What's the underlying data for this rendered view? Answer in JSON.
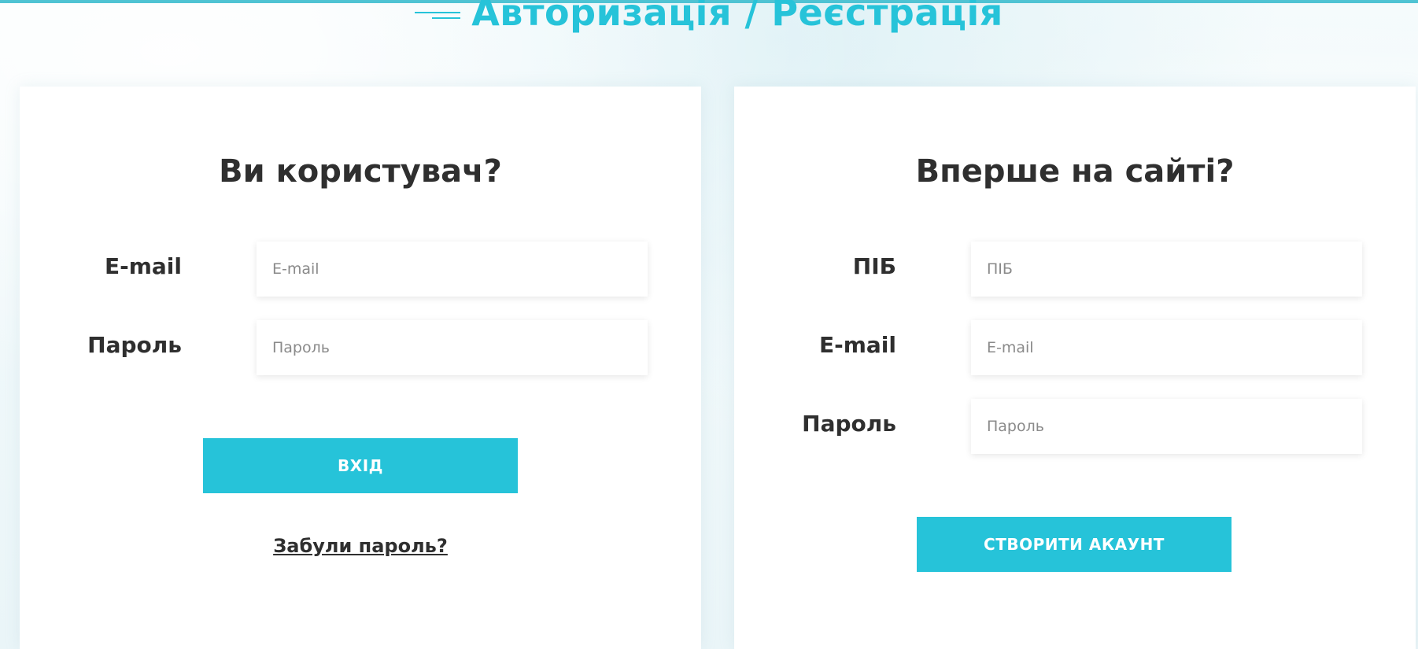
{
  "header": {
    "title": "Авторизація / Реєстрація",
    "icon": "menu-lines-icon",
    "accent_color": "#26c3d9"
  },
  "login": {
    "title": "Ви користувач?",
    "email": {
      "label": "E-mail",
      "placeholder": "E-mail",
      "value": ""
    },
    "password": {
      "label": "Пароль",
      "placeholder": "Пароль",
      "value": ""
    },
    "submit_label": "ВХІД",
    "forgot_label": "Забули пароль?"
  },
  "register": {
    "title": "Вперше на сайті?",
    "fullname": {
      "label": "ПІБ",
      "placeholder": "ПІБ",
      "value": ""
    },
    "email": {
      "label": "E-mail",
      "placeholder": "E-mail",
      "value": ""
    },
    "password": {
      "label": "Пароль",
      "placeholder": "Пароль",
      "value": ""
    },
    "submit_label": "СТВОРИТИ АКАУНТ"
  }
}
